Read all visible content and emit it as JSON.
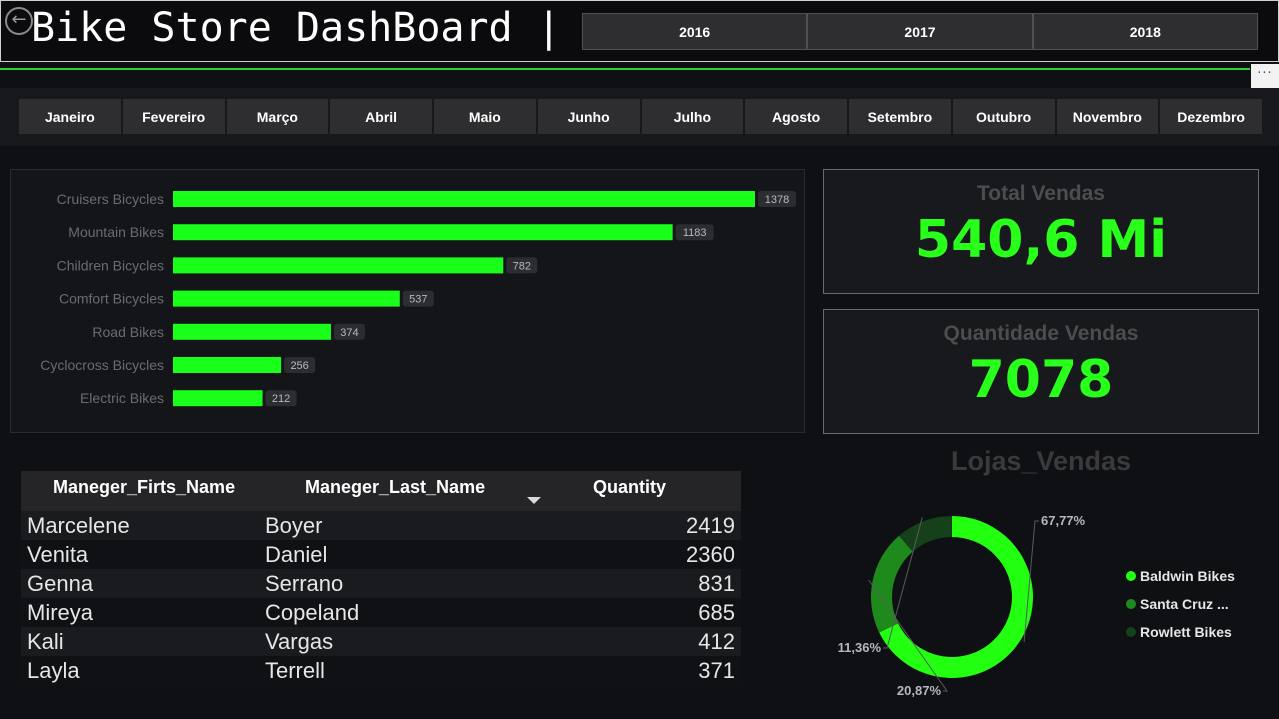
{
  "header": {
    "title": "Bike Store DashBoard |",
    "years": [
      "2016",
      "2017",
      "2018"
    ],
    "more": "···"
  },
  "months": [
    "Janeiro",
    "Fevereiro",
    "Março",
    "Abril",
    "Maio",
    "Junho",
    "Julho",
    "Agosto",
    "Setembro",
    "Outubro",
    "Novembro",
    "Dezembro"
  ],
  "chart_data": [
    {
      "type": "bar",
      "orientation": "horizontal",
      "categories": [
        "Cruisers Bicycles",
        "Mountain Bikes",
        "Children Bicycles",
        "Comfort Bicycles",
        "Road Bikes",
        "Cyclocross Bicycles",
        "Electric Bikes"
      ],
      "values": [
        1378,
        1183,
        782,
        537,
        374,
        256,
        212
      ],
      "data_labels": true,
      "bar_color": "#1aff1a",
      "grid": false
    },
    {
      "type": "pie",
      "variant": "donut",
      "title": "Lojas_Vendas",
      "categories": [
        "Baldwin Bikes",
        "Santa Cruz ...",
        "Rowlett Bikes"
      ],
      "values": [
        67.77,
        20.87,
        11.36
      ],
      "labels": [
        "67,77%",
        "20,87%",
        "11,36%"
      ],
      "colors": [
        "#22ff11",
        "#1f8a1c",
        "#15401a"
      ],
      "legend_position": "right"
    }
  ],
  "cards": {
    "total": {
      "label": "Total Vendas",
      "value": "540,6 Mi"
    },
    "qty": {
      "label": "Quantidade Vendas",
      "value": "7078"
    }
  },
  "table": {
    "headers": [
      "Maneger_Firts_Name",
      "Maneger_Last_Name",
      "Quantity"
    ],
    "rows": [
      [
        "Marcelene",
        "Boyer",
        "2419"
      ],
      [
        "Venita",
        "Daniel",
        "2360"
      ],
      [
        "Genna",
        "Serrano",
        "831"
      ],
      [
        "Mireya",
        "Copeland",
        "685"
      ],
      [
        "Kali",
        "Vargas",
        "412"
      ],
      [
        "Layla",
        "Terrell",
        "371"
      ]
    ]
  },
  "colors": {
    "accent": "#28ff1a",
    "background": "#0f1014",
    "button": "#2e2e30"
  }
}
